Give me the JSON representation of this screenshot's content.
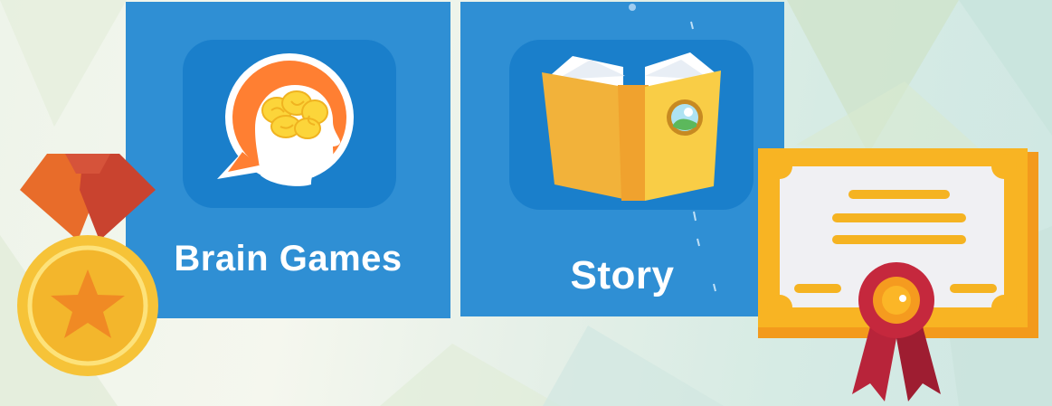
{
  "tiles": {
    "brain_games": {
      "label": "Brain Games",
      "icon": "brain-head-icon"
    },
    "story": {
      "label": "Story",
      "icon": "open-book-icon"
    }
  },
  "decorations": {
    "medal": "medal-icon",
    "certificate": "certificate-icon"
  },
  "colors": {
    "tile_bg": "#2f8fd4",
    "icon_box_bg": "#1a7fcb",
    "brain_orange": "#ff7f32",
    "book_yellow": "#f7c233",
    "ribbon_red": "#c0263a"
  }
}
